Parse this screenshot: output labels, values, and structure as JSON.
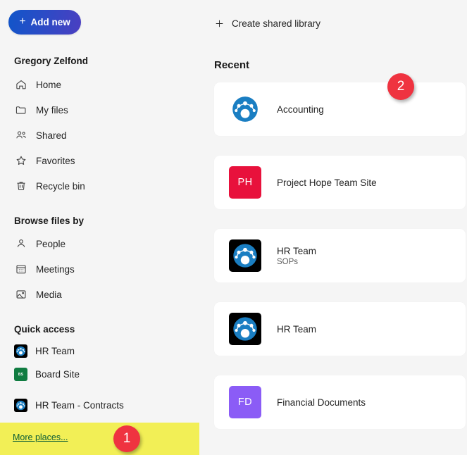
{
  "theme": {
    "page_bg": "#f5f5f5",
    "card_bg": "#ffffff",
    "accent_gradient_from": "#1155c9",
    "accent_gradient_to": "#4b3fc1",
    "badge_red": "#ef3340",
    "highlight_yellow": "#f2ef56",
    "link_green": "#0b5d35"
  },
  "sidebar": {
    "add_new_label": "Add new",
    "user_name": "Gregory Zelfond",
    "nav_items": [
      {
        "label": "Home",
        "icon": "home-icon"
      },
      {
        "label": "My files",
        "icon": "folder-icon"
      },
      {
        "label": "Shared",
        "icon": "people-shared-icon"
      },
      {
        "label": "Favorites",
        "icon": "star-icon"
      },
      {
        "label": "Recycle bin",
        "icon": "trash-icon"
      }
    ],
    "browse_heading": "Browse files by",
    "browse_items": [
      {
        "label": "People",
        "icon": "person-icon"
      },
      {
        "label": "Meetings",
        "icon": "calendar-icon"
      },
      {
        "label": "Media",
        "icon": "image-icon"
      }
    ],
    "quick_access_heading": "Quick access",
    "quick_access_items": [
      {
        "label": "HR Team",
        "icon": "sharepoint-team-icon",
        "tile_color": "#000000"
      },
      {
        "label": "Board Site",
        "icon": "site-initials-tile",
        "tile_color": "#107c41",
        "initials": "BS"
      },
      {
        "label": "HR Team - Contracts",
        "icon": "sharepoint-team-icon",
        "tile_color": "#000000"
      }
    ],
    "more_places_label": "More places..."
  },
  "main": {
    "create_shared_library_label": "Create shared library",
    "recent_heading": "Recent",
    "recent_items": [
      {
        "title": "Accounting",
        "subtitle": "",
        "icon": "sharepoint-circle-icon",
        "tile_color": "#ffffff",
        "initials": ""
      },
      {
        "title": "Project Hope Team Site",
        "subtitle": "",
        "icon": "site-initials-tile",
        "tile_color": "#e8113c",
        "initials": "PH"
      },
      {
        "title": "HR Team",
        "subtitle": "SOPs",
        "icon": "sharepoint-team-icon",
        "tile_color": "#000000",
        "initials": ""
      },
      {
        "title": "HR Team",
        "subtitle": "",
        "icon": "sharepoint-team-icon",
        "tile_color": "#000000",
        "initials": ""
      },
      {
        "title": "Financial Documents",
        "subtitle": "",
        "icon": "site-initials-tile",
        "tile_color": "#8b5cf6",
        "initials": "FD"
      }
    ]
  },
  "annotations": [
    {
      "number": "1",
      "target": "more-places-link"
    },
    {
      "number": "2",
      "target": "recent-section"
    }
  ]
}
